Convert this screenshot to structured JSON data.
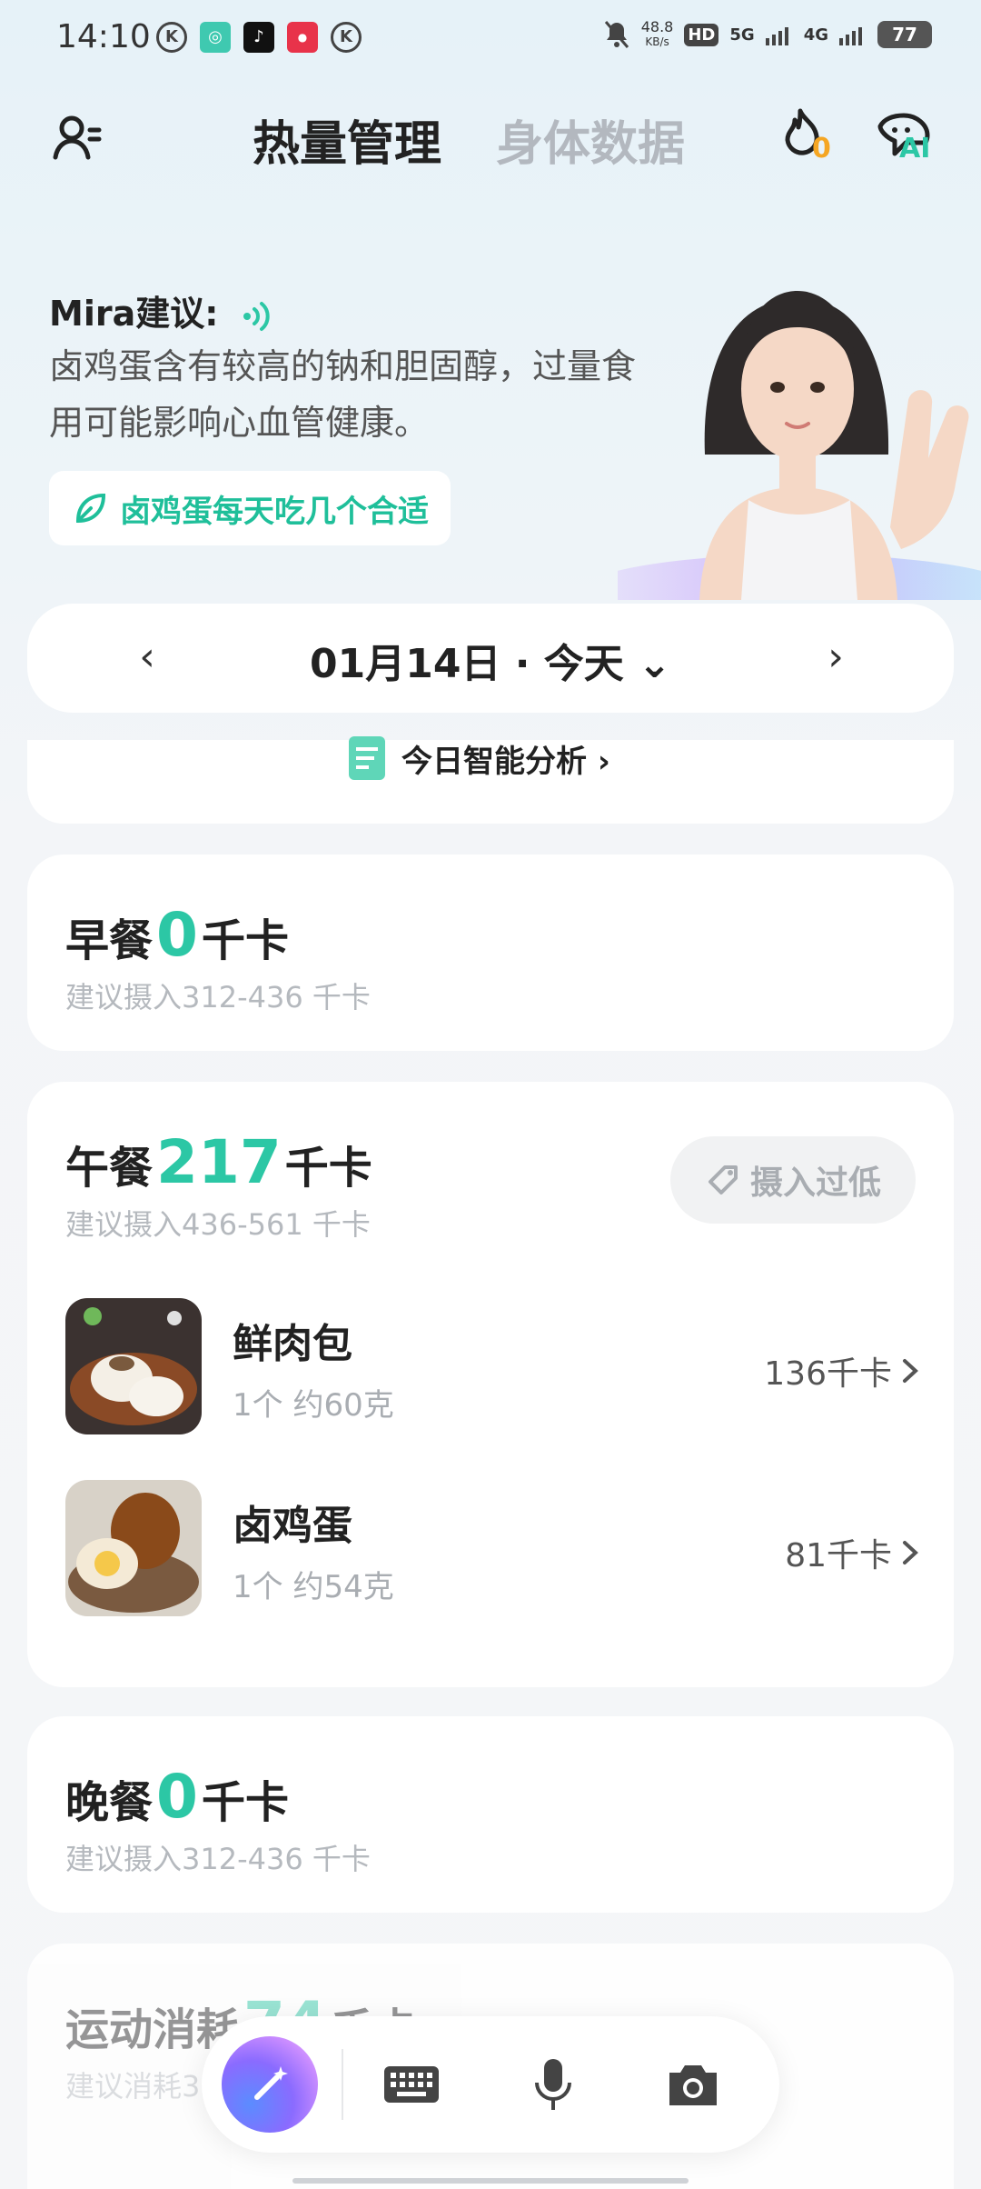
{
  "status_bar": {
    "time": "14:10",
    "net_speed": "48.8",
    "net_unit": "KB/s",
    "hd": "HD",
    "signal_5g": "5G",
    "signal_4g": "4G",
    "battery": "77"
  },
  "header": {
    "tab_active": "热量管理",
    "tab_inactive": "身体数据",
    "flame_count": "0",
    "ai_label": "AI"
  },
  "mira": {
    "title": "Mira建议:",
    "text": "卤鸡蛋含有较高的钠和胆固醇，过量食用可能影响心血管健康。",
    "button_label": "卤鸡蛋每天吃几个合适"
  },
  "date": {
    "label": "01月14日 · 今天 ⌄",
    "prev": "‹",
    "next": "›"
  },
  "analysis": {
    "label": "今日智能分析 ›"
  },
  "meals": {
    "breakfast": {
      "name": "早餐",
      "kcal": "0",
      "unit": "千卡",
      "suggest": "建议摄入312-436 千卡"
    },
    "lunch": {
      "name": "午餐",
      "kcal": "217",
      "unit": "千卡",
      "suggest": "建议摄入436-561 千卡",
      "status_button": "摄入过低",
      "foods": [
        {
          "name": "鲜肉包",
          "qty": "1个  约60克",
          "kcal": "136千卡"
        },
        {
          "name": "卤鸡蛋",
          "qty": "1个  约54克",
          "kcal": "81千卡"
        }
      ]
    },
    "dinner": {
      "name": "晚餐",
      "kcal": "0",
      "unit": "千卡",
      "suggest": "建议摄入312-436 千卡"
    },
    "exercise": {
      "name": "运动消耗",
      "kcal": "74",
      "unit": "千卡",
      "suggest": "建议消耗3"
    }
  },
  "colors": {
    "accent": "#2cc7a5",
    "brand_flame": "#f5a623"
  },
  "icons": [
    "profile-icon",
    "flame-icon",
    "ai-chat-icon",
    "sound-wave-icon",
    "leaf-icon",
    "notepad-icon",
    "magic-wand-icon",
    "keyboard-icon",
    "microphone-icon",
    "camera-icon"
  ]
}
